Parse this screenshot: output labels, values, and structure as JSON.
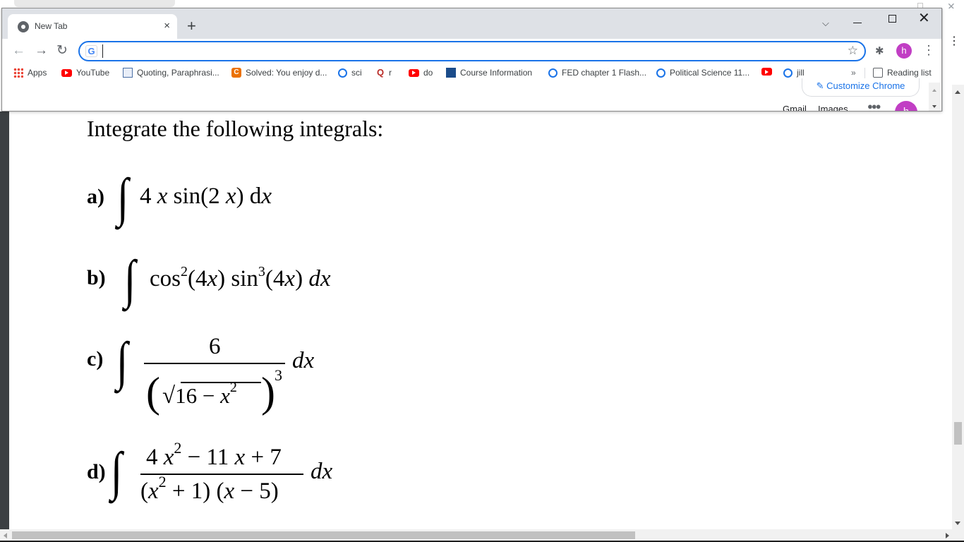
{
  "browser": {
    "tab_title": "New Tab",
    "tab_close": "×",
    "new_tab": "+",
    "omnibox_value": "",
    "omnibox_icon": "G",
    "profile_initial": "h"
  },
  "bookmarks": [
    {
      "label": "Apps",
      "icon": "apps-grid-icon"
    },
    {
      "label": "YouTube",
      "icon": "youtube-icon"
    },
    {
      "label": "Quoting, Paraphrasi...",
      "icon": "document-icon"
    },
    {
      "label": "Solved: You enjoy d...",
      "icon": "chegg-icon"
    },
    {
      "label": "sci",
      "icon": "quizlet-icon"
    },
    {
      "label": "r",
      "icon": "quora-icon"
    },
    {
      "label": "do",
      "icon": "youtube-icon"
    },
    {
      "label": "Course Information",
      "icon": "course-icon"
    },
    {
      "label": "FED chapter 1 Flash...",
      "icon": "quizlet-icon"
    },
    {
      "label": "Political Science 11...",
      "icon": "quizlet-icon"
    },
    {
      "label": "",
      "icon": "youtube-icon"
    },
    {
      "label": "jill",
      "icon": "quizlet-icon"
    }
  ],
  "bookmarks_overflow": "»",
  "reading_list": "Reading list",
  "newtab_peek": {
    "customize": "Customize Chrome",
    "gmail": "Gmail",
    "images": "Images",
    "avatar": "h"
  },
  "page": {
    "heading": "Integrate the following integrals:",
    "problems": [
      {
        "label": "a)",
        "expression": "4 x sin(2 x) dx"
      },
      {
        "label": "b)",
        "expression": "cos²(4x) sin³(4x) dx"
      },
      {
        "label": "c)",
        "numerator": "6",
        "denominator": "(√(16 − x²))³",
        "differential": "dx"
      },
      {
        "label": "d)",
        "numerator": "4 x² − 11 x + 7",
        "denominator": "(x² + 1) (x − 5)",
        "differential": "dx"
      }
    ]
  },
  "colors": {
    "accent": "#1a73e8",
    "profile": "#c13ec4",
    "titlebar": "#dee1e6"
  }
}
